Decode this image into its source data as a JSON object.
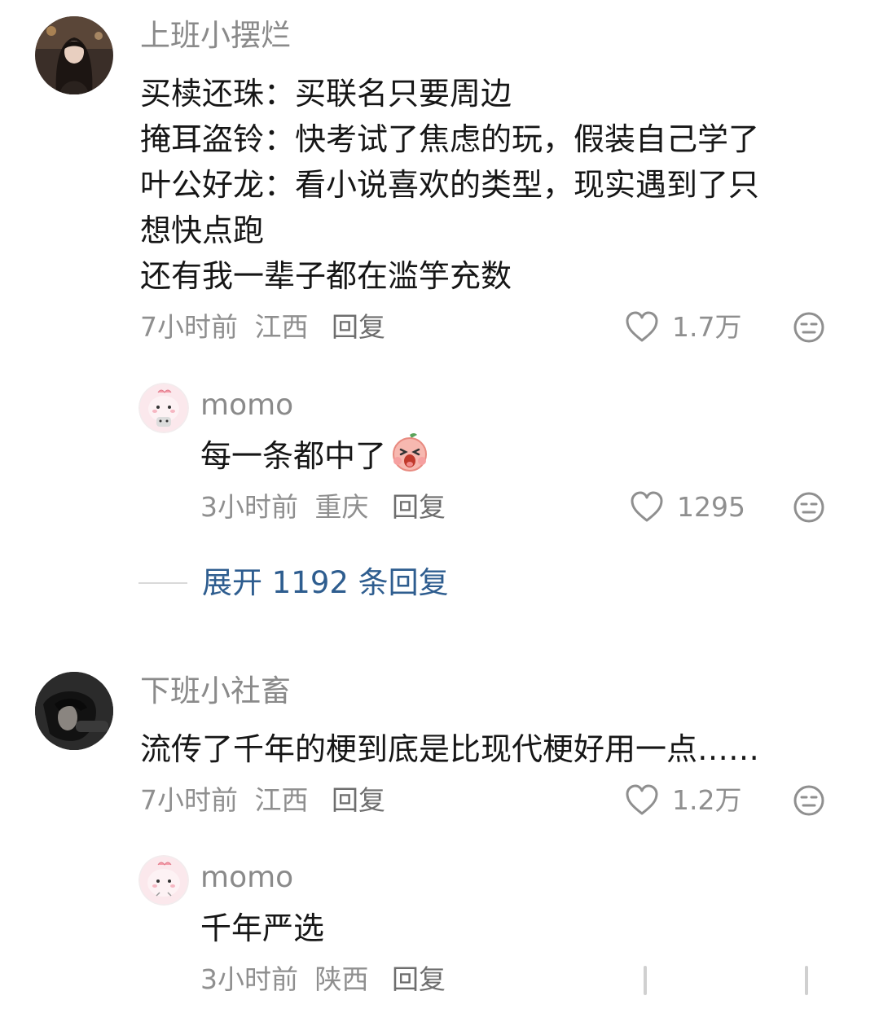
{
  "comments": [
    {
      "username": "上班小摆烂",
      "lines": [
        "买椟还珠：买联名只要周边",
        "掩耳盗铃：快考试了焦虑的玩，假装自己学了",
        "叶公好龙：看小说喜欢的类型，现实遇到了只",
        "想快点跑",
        "还有我一辈子都在滥竽充数"
      ],
      "time": "7小时前",
      "location": "江西",
      "reply_label": "回复",
      "likes": "1.7万",
      "avatar_icon": "woman-portrait-avatar",
      "reply": {
        "username": "momo",
        "text": "每一条都中了",
        "emoji": "shouting-peach-emoji",
        "time": "3小时前",
        "location": "重庆",
        "reply_label": "回复",
        "likes": "1295",
        "avatar_icon": "pink-cartoon-avatar"
      },
      "expand_label": "展开 1192 条回复"
    },
    {
      "username": "下班小社畜",
      "lines": [
        "流传了千年的梗到底是比现代梗好用一点……"
      ],
      "time": "7小时前",
      "location": "江西",
      "reply_label": "回复",
      "likes": "1.2万",
      "avatar_icon": "dark-portrait-avatar",
      "reply": {
        "username": "momo",
        "text": "千年严选",
        "time": "3小时前",
        "location": "陕西",
        "reply_label": "回复",
        "avatar_icon": "pink-cartoon-avatar"
      }
    }
  ],
  "colors": {
    "username": "#8a8a8a",
    "content": "#161616",
    "meta": "#8f8f8f",
    "expand_link": "#2e5d8f",
    "background": "#ffffff"
  }
}
